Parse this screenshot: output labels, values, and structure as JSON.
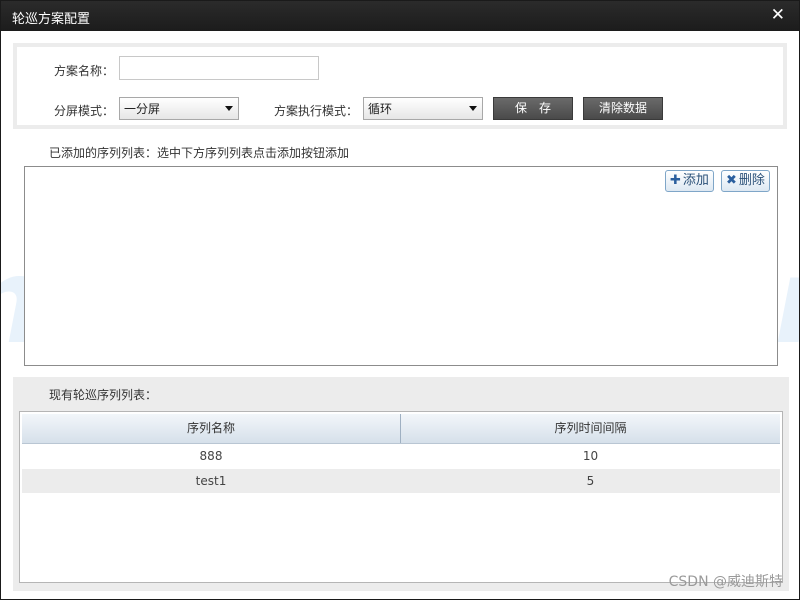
{
  "window": {
    "title": "轮巡方案配置",
    "close_glyph": "✕"
  },
  "form": {
    "name_label": "方案名称：",
    "name_value": "",
    "split_label": "分屏模式：",
    "split_value": "一分屏",
    "exec_label": "方案执行模式：",
    "exec_value": "循环",
    "save_label": "保　存",
    "clear_label": "清除数据"
  },
  "added": {
    "caption": "已添加的序列列表：选中下方序列列表点击添加按钮添加",
    "add_label": "添加",
    "add_icon": "plus-icon",
    "delete_label": "删除",
    "delete_icon": "x-icon"
  },
  "watermark": "n , vidisit.cn , v",
  "existing": {
    "caption": "现有轮巡序列列表：",
    "columns": [
      "序列名称",
      "序列时间间隔"
    ],
    "rows": [
      {
        "name": "888",
        "interval": "10"
      },
      {
        "name": "test1",
        "interval": "5"
      }
    ]
  },
  "credit": "CSDN @威迪斯特",
  "colors": {
    "titlebar": "#1c1c1c",
    "button_dark": "#555555",
    "panel_gray": "#ececec",
    "row_alt": "#ececec"
  }
}
